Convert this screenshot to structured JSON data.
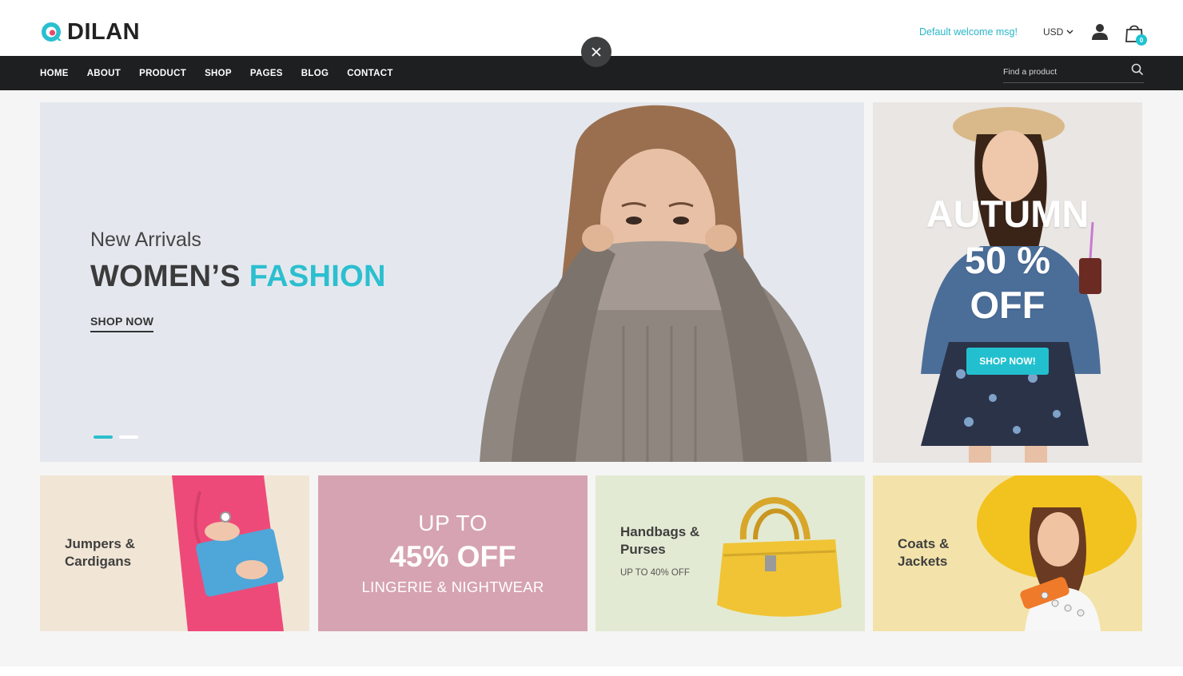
{
  "header": {
    "logo_text": "DILAN",
    "welcome": "Default welcome msg!",
    "currency": "USD",
    "cart_count": "0"
  },
  "nav": {
    "items": [
      "HOME",
      "ABOUT",
      "PRODUCT",
      "SHOP",
      "PAGES",
      "BLOG",
      "CONTACT"
    ],
    "search_placeholder": "Find a product"
  },
  "hero": {
    "subtitle": "New Arrivals",
    "title_main": "WOMEN’S",
    "title_accent": "FASHION",
    "cta": "SHOP NOW",
    "slide_count": 2,
    "active_slide": 1
  },
  "side_banner": {
    "line1": "AUTUMN",
    "line2": "50 %",
    "line3": "OFF",
    "cta": "SHOP NOW!"
  },
  "tiles": [
    {
      "title_line1": "Jumpers &",
      "title_line2": "Cardigans"
    },
    {
      "line1": "UP TO",
      "line2": "45% OFF",
      "line3": "LINGERIE & NIGHTWEAR"
    },
    {
      "title_line1": "Handbags &",
      "title_line2": "Purses",
      "subtitle": "UP TO 40% OFF"
    },
    {
      "title_line1": "Coats &",
      "title_line2": "Jackets"
    }
  ],
  "colors": {
    "accent": "#2bbfcf",
    "nav_bg": "#1d1f20",
    "hero_bg": "#e4e8ee",
    "tile_pink": "#d6a3b2"
  }
}
